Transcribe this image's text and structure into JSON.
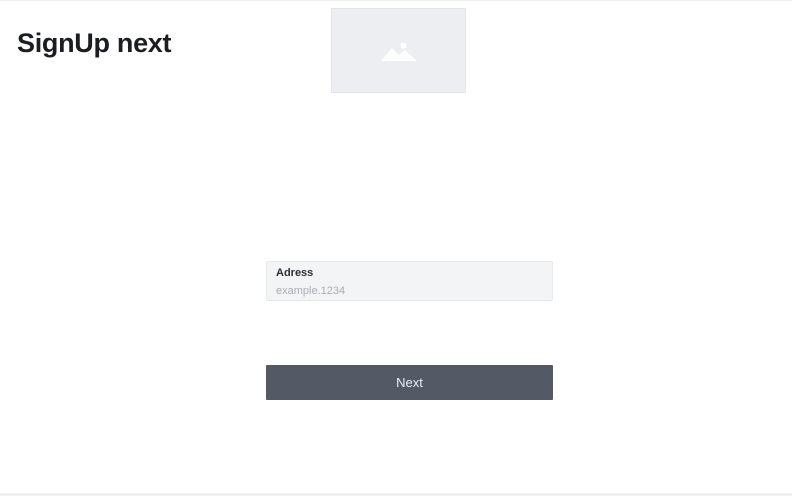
{
  "header": {
    "title": "SignUp next"
  },
  "hero_image": {
    "icon": "image-placeholder-icon"
  },
  "form": {
    "address": {
      "label": "Adress",
      "value": "",
      "placeholder": "example.1234"
    },
    "next_label": "Next"
  },
  "colors": {
    "button": "#545966",
    "field_background": "#f3f4f6",
    "placeholder_background": "#eceef1"
  }
}
